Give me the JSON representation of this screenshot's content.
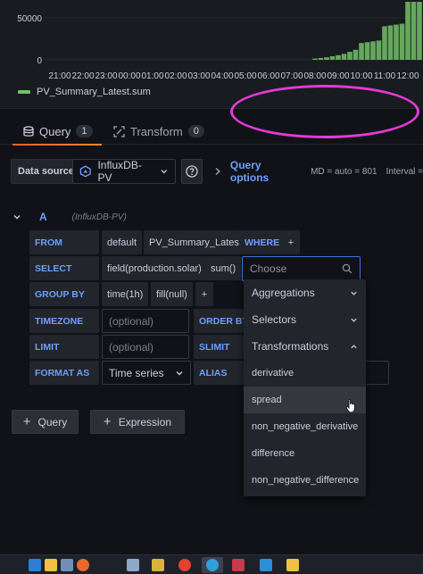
{
  "chart_data": {
    "type": "bar",
    "ylim": [
      0,
      80000
    ],
    "y_ticks": [
      "50000",
      "0"
    ],
    "categories": [
      "21:00",
      "22:00",
      "23:00",
      "00:00",
      "01:00",
      "02:00",
      "03:00",
      "04:00",
      "05:00",
      "06:00",
      "07:00",
      "08:00",
      "09:00",
      "10:00",
      "11:00",
      "12:00"
    ],
    "bars": [
      {
        "x": 8.0,
        "value": 1500
      },
      {
        "x": 8.25,
        "value": 2200
      },
      {
        "x": 8.5,
        "value": 3000
      },
      {
        "x": 8.75,
        "value": 4200
      },
      {
        "x": 9.0,
        "value": 5500
      },
      {
        "x": 9.25,
        "value": 7000
      },
      {
        "x": 9.5,
        "value": 9500
      },
      {
        "x": 9.75,
        "value": 12000
      },
      {
        "x": 10.0,
        "value": 20000
      },
      {
        "x": 10.25,
        "value": 21000
      },
      {
        "x": 10.5,
        "value": 22000
      },
      {
        "x": 10.75,
        "value": 23000
      },
      {
        "x": 11.0,
        "value": 40000
      },
      {
        "x": 11.25,
        "value": 41000
      },
      {
        "x": 11.5,
        "value": 42000
      },
      {
        "x": 11.75,
        "value": 43000
      },
      {
        "x": 12.0,
        "value": 73000
      },
      {
        "x": 12.25,
        "value": 76000
      },
      {
        "x": 12.5,
        "value": 78000
      }
    ],
    "series": [
      {
        "name": "PV_Summary_Latest.sum",
        "color": "#73bf69"
      }
    ],
    "legend": "bottom-left",
    "grid": true
  },
  "tabs": [
    {
      "label": "Query",
      "count": "1"
    },
    {
      "label": "Transform",
      "count": "0"
    }
  ],
  "datasource": {
    "label": "Data source",
    "value": "InfluxDB-PV",
    "query_options": "Query options",
    "md": "MD = auto = 801",
    "interval": "Interval ="
  },
  "query": {
    "letter": "A",
    "datasource": "(InfluxDB-PV)",
    "from": {
      "keyword": "FROM",
      "policy": "default",
      "measurement": "PV_Summary_Latest",
      "where": "WHERE",
      "add": "+"
    },
    "select": {
      "keyword": "SELECT",
      "field": "field(production.solar)",
      "fn": "sum()"
    },
    "group_by": {
      "keyword": "GROUP BY",
      "time": "time(1h)",
      "fill": "fill(null)",
      "add": "+"
    },
    "timezone": {
      "keyword": "TIMEZONE",
      "placeholder": "(optional)",
      "order_by": "ORDER BY T"
    },
    "limit": {
      "keyword": "LIMIT",
      "placeholder": "(optional)",
      "slimit": "SLIMIT"
    },
    "format_as": {
      "keyword": "FORMAT AS",
      "value": "Time series",
      "alias": "ALIAS"
    }
  },
  "dropdown": {
    "placeholder": "Choose",
    "groups": [
      {
        "label": "Aggregations",
        "expanded": false
      },
      {
        "label": "Selectors",
        "expanded": false
      },
      {
        "label": "Transformations",
        "expanded": true
      }
    ],
    "options": [
      "derivative",
      "spread",
      "non_negative_derivative",
      "difference",
      "non_negative_difference"
    ],
    "hovered": "spread"
  },
  "buttons": {
    "query": "Query",
    "expression": "Expression"
  },
  "colors": {
    "accent": "#6e9fff",
    "bar": "#73bf69",
    "annotation": "#e23bd6",
    "tab_underline": "#ff8833"
  }
}
